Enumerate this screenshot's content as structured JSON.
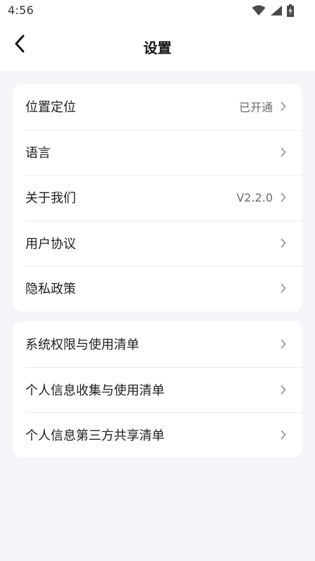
{
  "status_bar": {
    "time": "4:56",
    "icons": [
      "wifi-icon",
      "signal-icon",
      "battery-charging-icon"
    ]
  },
  "header": {
    "title": "设置",
    "back_icon": "chevron-left-icon"
  },
  "groups": [
    {
      "items": [
        {
          "label": "位置定位",
          "value": "已开通"
        },
        {
          "label": "语言",
          "value": ""
        },
        {
          "label": "关于我们",
          "value": "V2.2.0"
        },
        {
          "label": "用户协议",
          "value": ""
        },
        {
          "label": "隐私政策",
          "value": ""
        }
      ]
    },
    {
      "items": [
        {
          "label": "系统权限与使用清单",
          "value": ""
        },
        {
          "label": "个人信息收集与使用清单",
          "value": ""
        },
        {
          "label": "个人信息第三方共享清单",
          "value": ""
        }
      ]
    }
  ],
  "colors": {
    "background": "#f4f5f9",
    "card": "#ffffff",
    "divider": "#ececec",
    "secondary_text": "#6b6b6b"
  }
}
